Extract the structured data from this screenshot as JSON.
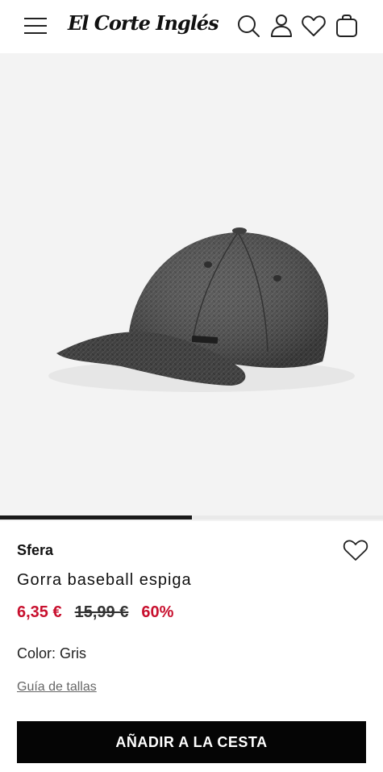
{
  "header": {
    "logo_text": "El Corte Inglés",
    "icons": [
      "menu-icon",
      "search-icon",
      "user-icon",
      "heart-icon",
      "bag-icon"
    ]
  },
  "gallery": {
    "image_alt": "cap",
    "progress": 0.5
  },
  "product": {
    "brand": "Sfera",
    "name": "Gorra baseball espiga",
    "price": "6,35 €",
    "old_price": "15,99 €",
    "discount": "60%",
    "color_label": "Color: Gris",
    "size_guide": "Guía de tallas",
    "add_button": "AÑADIR A LA CESTA"
  },
  "colors": {
    "sale": "#c8102e",
    "button_bg": "#050505",
    "hero_bg": "#f3f3f3"
  }
}
